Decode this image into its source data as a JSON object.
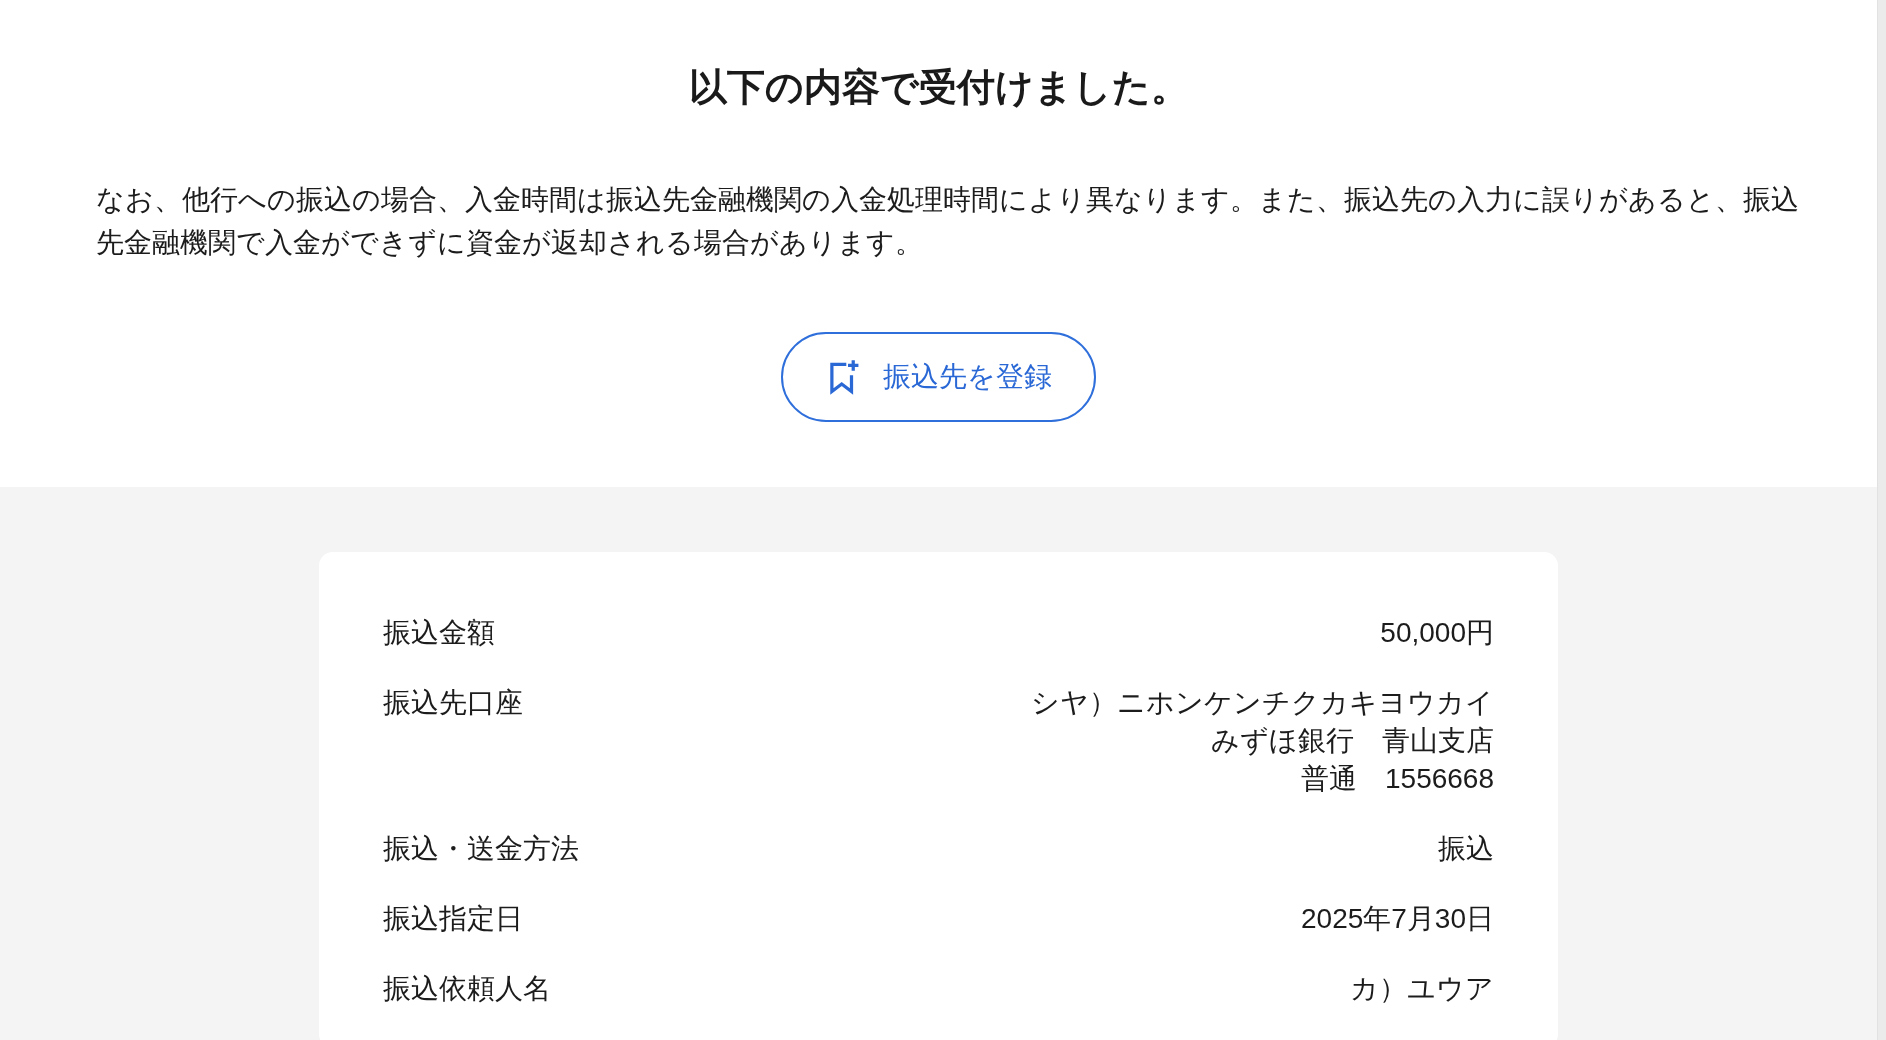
{
  "heading": "以下の内容で受付けました。",
  "notice": "なお、他行への振込の場合、入金時間は振込先金融機関の入金処理時間により異なります。また、振込先の入力に誤りがあると、振込先金融機関で入金ができずに資金が返却される場合があります。",
  "register_button": {
    "label": "振込先を登録"
  },
  "details": [
    {
      "label": "振込金額",
      "value_lines": [
        "50,000円"
      ]
    },
    {
      "label": "振込先口座",
      "value_lines": [
        "シヤ）ニホンケンチクカキヨウカイ",
        "みずほ銀行　青山支店",
        "普通　1556668"
      ]
    },
    {
      "label": "振込・送金方法",
      "value_lines": [
        "振込"
      ]
    },
    {
      "label": "振込指定日",
      "value_lines": [
        "2025年7月30日"
      ]
    },
    {
      "label": "振込依頼人名",
      "value_lines": [
        "カ）ユウア"
      ]
    }
  ]
}
